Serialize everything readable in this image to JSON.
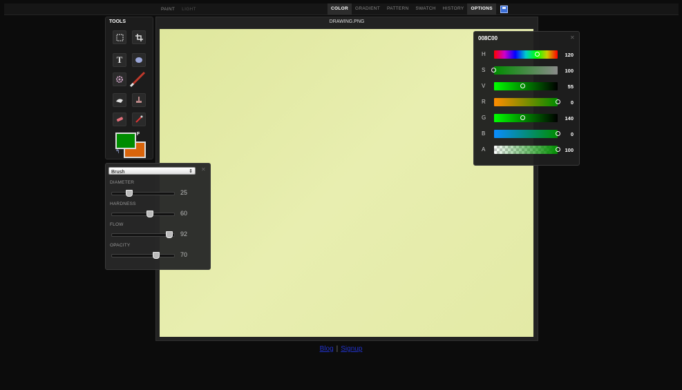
{
  "menu": {
    "left": [
      "PAINT",
      "LIGHT"
    ],
    "right": [
      "COLOR",
      "GRADIENT",
      "PATTERN",
      "SWATCH",
      "HISTORY",
      "OPTIONS"
    ]
  },
  "tools_panel": {
    "title": "TOOLS",
    "icons": [
      "marquee-select",
      "crop",
      "text",
      "ellipse",
      "gear",
      "brush",
      "smudge",
      "stamp",
      "eraser",
      "eyedropper"
    ],
    "foreground_color": "#008C00",
    "background_color": "#D9640B",
    "fg_label": "F"
  },
  "canvas": {
    "title": "DRAWING.PNG"
  },
  "brush_panel": {
    "preset": "Brush",
    "sliders": [
      {
        "label": "DIAMETER",
        "value": "25"
      },
      {
        "label": "HARDNESS",
        "value": "60"
      },
      {
        "label": "FLOW",
        "value": "92"
      },
      {
        "label": "OPACITY",
        "value": "70"
      }
    ]
  },
  "color_panel": {
    "hex": "008C00",
    "channels": [
      {
        "label": "H",
        "value": "120"
      },
      {
        "label": "S",
        "value": "100"
      },
      {
        "label": "V",
        "value": "55"
      },
      {
        "label": "R",
        "value": "0"
      },
      {
        "label": "G",
        "value": "140"
      },
      {
        "label": "B",
        "value": "0"
      },
      {
        "label": "A",
        "value": "100"
      }
    ]
  },
  "footer": {
    "blog": "Blog",
    "separator": "|",
    "signup": "Signup"
  }
}
